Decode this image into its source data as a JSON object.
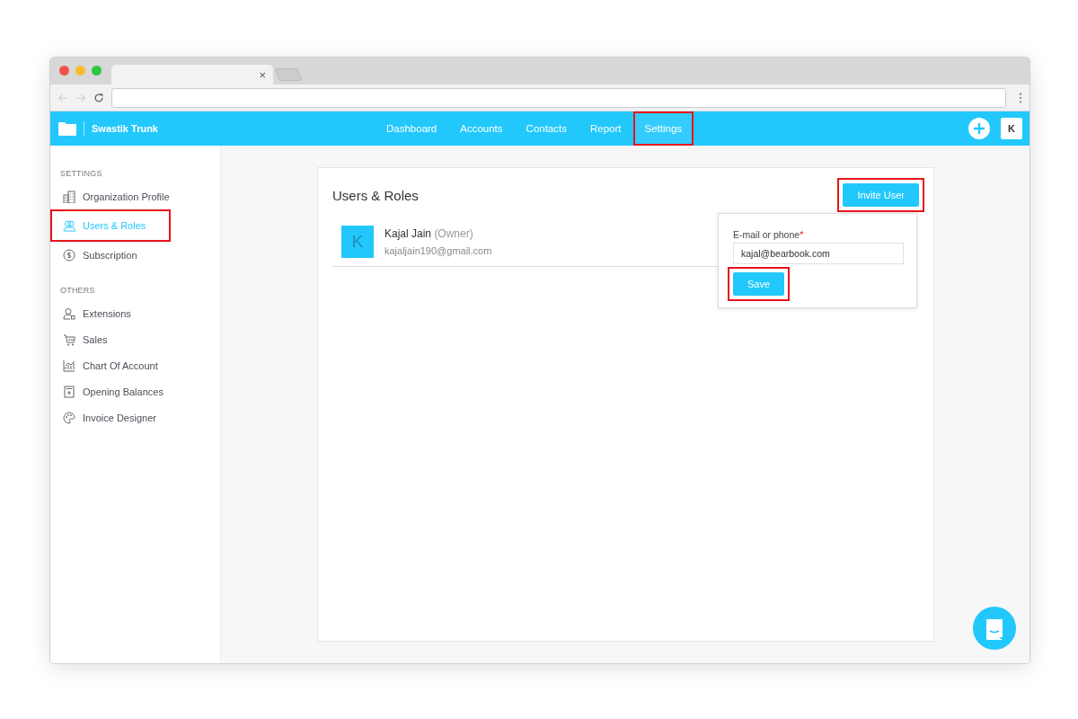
{
  "browser": {
    "tab_close": "×"
  },
  "app": {
    "name": "Swastik Trunk",
    "avatar": "K"
  },
  "nav": [
    {
      "label": "Dashboard",
      "selected": false,
      "highlighted": false
    },
    {
      "label": "Accounts",
      "selected": false,
      "highlighted": false
    },
    {
      "label": "Contacts",
      "selected": false,
      "highlighted": false
    },
    {
      "label": "Report",
      "selected": false,
      "highlighted": false
    },
    {
      "label": "Settings",
      "selected": true,
      "highlighted": true
    }
  ],
  "sidebar": [
    {
      "heading": "SETTINGS",
      "items": [
        {
          "label": "Organization Profile",
          "selected": false,
          "highlighted": false
        },
        {
          "label": "Users & Roles",
          "selected": true,
          "highlighted": true
        },
        {
          "label": "Subscription",
          "selected": false,
          "highlighted": false
        }
      ]
    },
    {
      "heading": "OTHERS",
      "items": [
        {
          "label": "Extensions",
          "selected": false,
          "highlighted": false
        },
        {
          "label": "Sales",
          "selected": false,
          "highlighted": false
        },
        {
          "label": "Chart Of Account",
          "selected": false,
          "highlighted": false
        },
        {
          "label": "Opening Balances",
          "selected": false,
          "highlighted": false
        },
        {
          "label": "Invoice Designer",
          "selected": false,
          "highlighted": false
        }
      ]
    }
  ],
  "page": {
    "title": "Users & Roles",
    "invite_button": {
      "label": "Invite User",
      "highlighted": true
    }
  },
  "users": [
    {
      "initial": "K",
      "name": "Kajal Jain",
      "role": "(Owner)",
      "email": "kajaljain190@gmail.com"
    }
  ],
  "invite_popup": {
    "label": "E-mail or phone",
    "required_mark": "*",
    "value": "kajal@bearbook.com",
    "save_button": {
      "label": "Save",
      "highlighted": true
    }
  }
}
